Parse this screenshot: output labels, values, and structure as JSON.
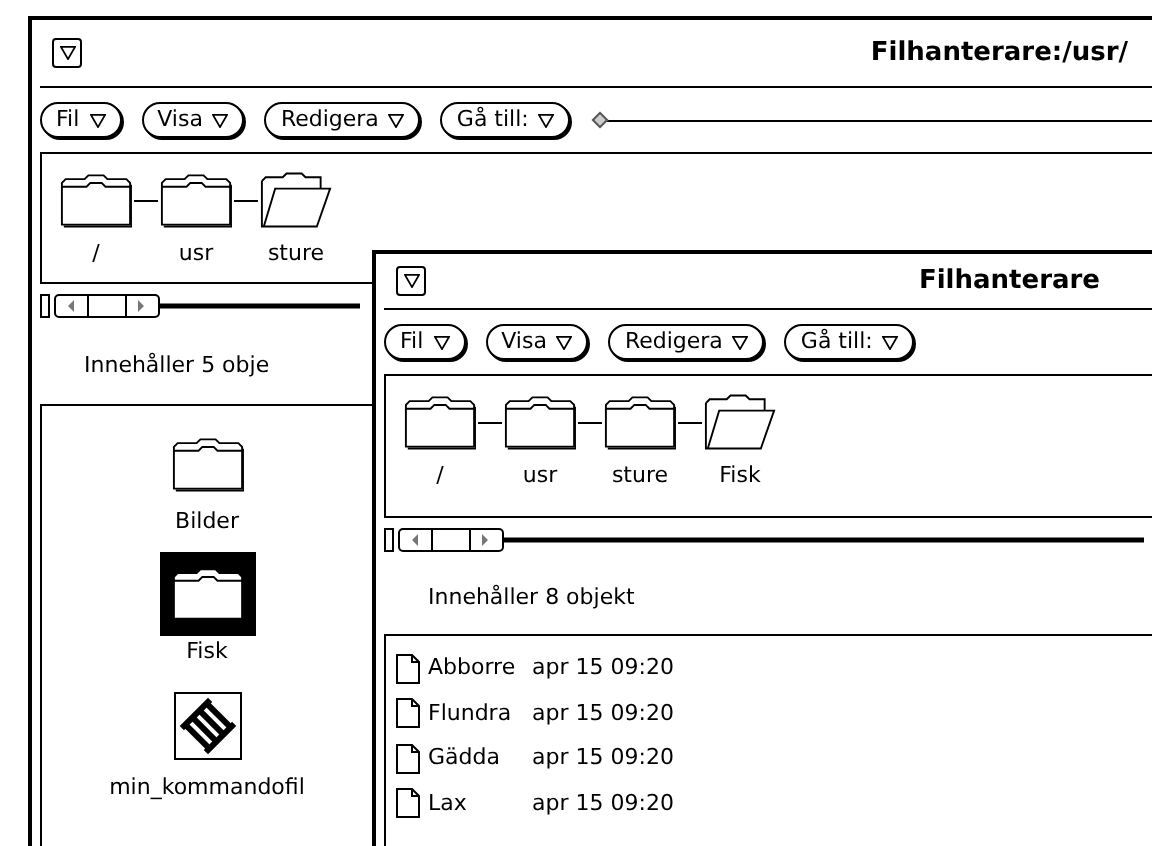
{
  "windows": [
    {
      "title": "Filhanterare:/usr/",
      "menus": [
        {
          "label": "Fil"
        },
        {
          "label": "Visa"
        },
        {
          "label": "Redigera"
        },
        {
          "label": "Gå till:"
        }
      ],
      "has_goto_field": true,
      "path": [
        {
          "label": "/",
          "open": false
        },
        {
          "label": "usr",
          "open": false
        },
        {
          "label": "sture",
          "open": true
        }
      ],
      "status": "Innehåller 5 obje",
      "items": [
        {
          "name": "Bilder",
          "kind": "folder",
          "selected": false
        },
        {
          "name": "Fisk",
          "kind": "folder",
          "selected": true
        },
        {
          "name": "min_kommandofil",
          "kind": "command",
          "selected": false
        }
      ]
    },
    {
      "title": "Filhanterare",
      "menus": [
        {
          "label": "Fil"
        },
        {
          "label": "Visa"
        },
        {
          "label": "Redigera"
        },
        {
          "label": "Gå till:"
        }
      ],
      "path": [
        {
          "label": "/",
          "open": false
        },
        {
          "label": "usr",
          "open": false
        },
        {
          "label": "sture",
          "open": false
        },
        {
          "label": "Fisk",
          "open": true
        }
      ],
      "status": "Innehåller 8 objekt",
      "items": [
        {
          "name": "Abborre",
          "date": "apr 15 09:20",
          "kind": "file",
          "selected": false
        },
        {
          "name": "Flundra",
          "date": "apr 15 09:20",
          "kind": "file",
          "selected": false
        },
        {
          "name": "Gädda",
          "date": "apr 15 09:20",
          "kind": "file",
          "selected": false
        },
        {
          "name": "Lax",
          "date": "apr 15 09:20",
          "kind": "file",
          "selected": false
        }
      ]
    }
  ]
}
